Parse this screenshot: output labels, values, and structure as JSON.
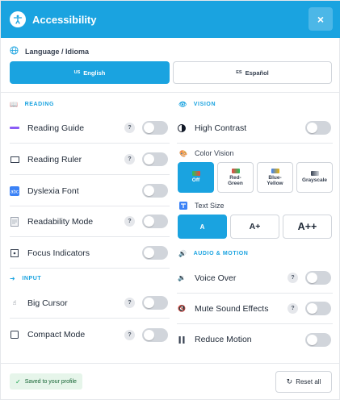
{
  "header": {
    "title": "Accessibility",
    "close_label": "×"
  },
  "language": {
    "label": "Language / Idioma",
    "options": [
      {
        "code": "US",
        "label": "English",
        "active": true
      },
      {
        "code": "ES",
        "label": "Español",
        "active": false
      }
    ]
  },
  "reading": {
    "title": "READING",
    "items": [
      {
        "label": "Reading Guide",
        "help": "?",
        "on": false
      },
      {
        "label": "Reading Ruler",
        "help": "?",
        "on": false
      },
      {
        "label": "Dyslexia Font",
        "on": false
      },
      {
        "label": "Readability Mode",
        "help": "?",
        "on": false
      },
      {
        "label": "Focus Indicators",
        "on": false
      }
    ]
  },
  "input": {
    "title": "INPUT",
    "items": [
      {
        "label": "Big Cursor",
        "help": "?",
        "on": false
      },
      {
        "label": "Compact Mode",
        "help": "?",
        "on": false
      }
    ]
  },
  "vision": {
    "title": "VISION",
    "high_contrast": {
      "label": "High Contrast",
      "on": false
    },
    "color_vision": {
      "label": "Color Vision",
      "options": [
        {
          "label": "Off",
          "active": true
        },
        {
          "label": "Red-Green",
          "line1": "Red-",
          "line2": "Green",
          "active": false
        },
        {
          "label": "Blue-Yellow",
          "line1": "Blue-",
          "line2": "Yellow",
          "active": false
        },
        {
          "label": "Grayscale",
          "active": false
        }
      ]
    },
    "text_size": {
      "label": "Text Size",
      "options": [
        {
          "label": "A",
          "active": true
        },
        {
          "label": "A+",
          "active": false
        },
        {
          "label": "A++",
          "active": false
        }
      ]
    }
  },
  "audio": {
    "title": "AUDIO & MOTION",
    "items": [
      {
        "label": "Voice Over",
        "help": "?",
        "on": false
      },
      {
        "label": "Mute Sound Effects",
        "help": "?",
        "on": false
      },
      {
        "label": "Reduce Motion",
        "on": false
      }
    ]
  },
  "footer": {
    "saved_text": "Saved to your profile",
    "reset_label": "Reset all"
  },
  "colors": {
    "accent": "#1aa3e0",
    "toggle_off": "#d1d5db",
    "saved_bg": "#e6f5ea"
  }
}
